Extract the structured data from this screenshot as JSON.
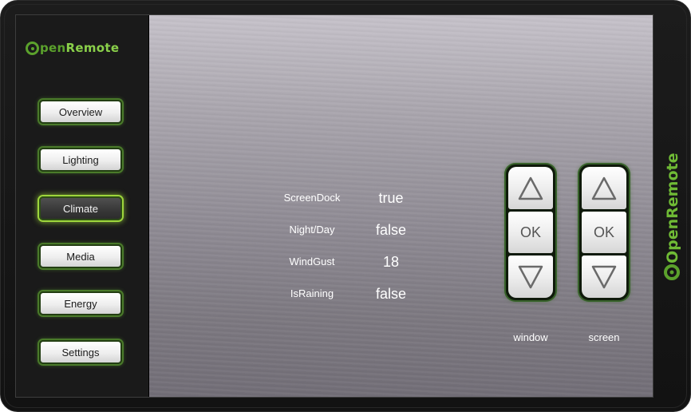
{
  "app": {
    "logo": {
      "prefix": "pen",
      "suffix": "Remote"
    }
  },
  "nav": {
    "items": [
      {
        "label": "Overview"
      },
      {
        "label": "Lighting"
      },
      {
        "label": "Climate"
      },
      {
        "label": "Media"
      },
      {
        "label": "Energy"
      },
      {
        "label": "Settings"
      }
    ],
    "active": "Climate"
  },
  "sensors": [
    {
      "label": "ScreenDock",
      "value": "true"
    },
    {
      "label": "Night/Day",
      "value": "false"
    },
    {
      "label": "WindGust",
      "value": "18"
    },
    {
      "label": "IsRaining",
      "value": "false"
    }
  ],
  "controls": [
    {
      "caption": "window",
      "ok_label": "OK"
    },
    {
      "caption": "screen",
      "ok_label": "OK"
    }
  ],
  "side_logo": {
    "text": "OpenRemote"
  },
  "colors": {
    "brand_green": "#5ba12c",
    "brand_green_light": "#8ad04a",
    "active_glow": "#9ed63c"
  },
  "icons": [
    "triangle-up-icon",
    "triangle-down-icon",
    "openremote-logo-icon"
  ]
}
